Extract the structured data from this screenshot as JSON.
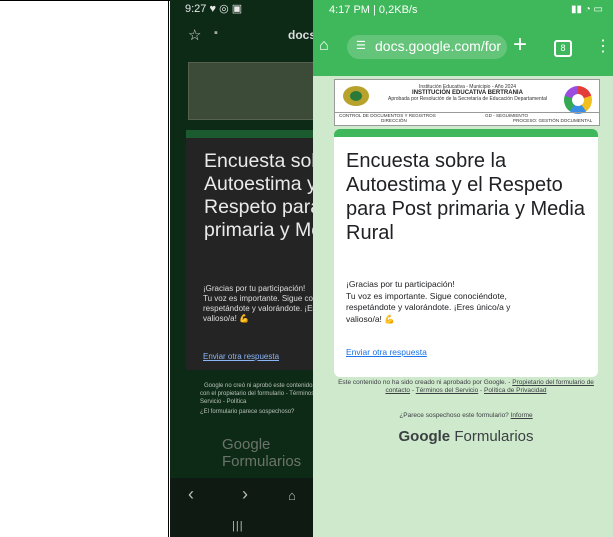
{
  "left_phone": {
    "status_time": "9:27",
    "status_icons": "♥ ◎ ▣",
    "url": "docs",
    "heading": "Encuesta sobre la Autoestima y el Respeto para Post primaria y Media Rural",
    "message": "¡Gracias por tu participación!\nTu voz es importante. Sigue conociéndote,\nrespetándote y valorándote. ¡Eres único/a y\nvalioso/a! 💪",
    "link": "Enviar otra respuesta",
    "footer_line1": "Google no creó ni aprobó este contenido.",
    "footer_line2": "con el propietario del formulario - Términos del Servicio - Política",
    "footer_line3": "¿El formulario parece sospechoso?",
    "brand": "Google Formularios"
  },
  "right_phone": {
    "status_time": "4:17 PM | 0,2KB/s",
    "status_right": "▮▮ ◔ ▭",
    "url": "docs.google.com/for",
    "tabs_count": "8",
    "banner": {
      "org_name": "INSTITUCIÓN EDUCATIVA BERTRANIA",
      "org_top": "Institución Educativa - Municipio - Año 2024",
      "org_sub": "Aprobada por Resolución de la Secretaría de Educación Departamental",
      "row_left": "CONTROL DE DOCUMENTOS Y REGISTROS",
      "row_mid": "DIRECCIÓN",
      "row_code": "GD - SEGUIMIENTO",
      "row_right": "PROCESO: GESTIÓN DOCUMENTAL"
    },
    "heading": "Encuesta sobre la Autoestima y el Respeto para Post primaria y Media Rural",
    "message": "¡Gracias por tu participación!\nTu voz es importante. Sigue conociéndote,\nrespetándote y valorándote. ¡Eres único/a y\nvalioso/a! 💪",
    "link": "Enviar otra respuesta",
    "footer_intro": "Este contenido no ha sido creado ni aprobado por Google.",
    "footer_contact": "Propietario del formulario de contacto",
    "footer_terms": "Términos del Servicio",
    "footer_privacy": "Política de Privacidad",
    "report_question": "¿Parece sospechoso este formulario?",
    "report_link": "Informe",
    "brand_google": "Google",
    "brand_product": "Formularios"
  },
  "colors": {
    "left_background": "#0d2a17",
    "right_background": "#cfe9cc",
    "accent_green": "#3eb85a",
    "link_blue": "#1a73e8"
  }
}
